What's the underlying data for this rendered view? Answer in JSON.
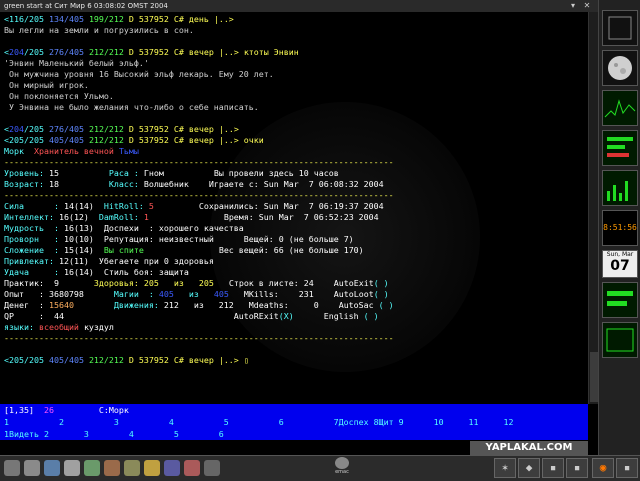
{
  "window": {
    "title": "green start at Сит Мир  6 03:08:02 OMST 2004"
  },
  "terminal": {
    "lines": [
      {
        "segs": [
          {
            "t": "<116/205 ",
            "c": "cyan"
          },
          {
            "t": "134/405 ",
            "c": "blue"
          },
          {
            "t": "199/212 ",
            "c": "green"
          },
          {
            "t": "D 537952 C# день |..> ",
            "c": "yellow"
          }
        ]
      },
      {
        "segs": [
          {
            "t": "Вы легли на земли и погрузились в сон.",
            "c": "grey"
          }
        ]
      },
      {
        "segs": [
          {
            "t": "",
            "c": "grey"
          }
        ]
      },
      {
        "segs": [
          {
            "t": "<",
            "c": "cyan"
          },
          {
            "t": "204",
            "c": "dblue"
          },
          {
            "t": "/205 ",
            "c": "cyan"
          },
          {
            "t": "276/405 ",
            "c": "blue"
          },
          {
            "t": "212/212 ",
            "c": "green"
          },
          {
            "t": "D 537952 C# вечер |..> ",
            "c": "yellow"
          },
          {
            "t": "ктоты Энвин",
            "c": "yellow"
          }
        ]
      },
      {
        "segs": [
          {
            "t": "'Энвин Маленький белый эльф.'",
            "c": "grey"
          }
        ]
      },
      {
        "segs": [
          {
            "t": " Он мужчина уровня 16 Высокий эльф лекарь. Ему 20 лет.",
            "c": "grey"
          }
        ]
      },
      {
        "segs": [
          {
            "t": " Он мирный игрок.",
            "c": "grey"
          }
        ]
      },
      {
        "segs": [
          {
            "t": " Он поклоняется Ульмо.",
            "c": "grey"
          }
        ]
      },
      {
        "segs": [
          {
            "t": " У Энвина не было желания что-либо о себе написать.",
            "c": "grey"
          }
        ]
      },
      {
        "segs": [
          {
            "t": "",
            "c": "grey"
          }
        ]
      },
      {
        "segs": [
          {
            "t": "<",
            "c": "cyan"
          },
          {
            "t": "204",
            "c": "dblue"
          },
          {
            "t": "/205 ",
            "c": "cyan"
          },
          {
            "t": "276/405 ",
            "c": "blue"
          },
          {
            "t": "212/212 ",
            "c": "green"
          },
          {
            "t": "D 537952 C# вечер |..>",
            "c": "yellow"
          }
        ]
      },
      {
        "segs": [
          {
            "t": "<205/205 ",
            "c": "cyan"
          },
          {
            "t": "405/405 ",
            "c": "blue"
          },
          {
            "t": "212/212 ",
            "c": "green"
          },
          {
            "t": "D 537952 C# вечер |..> ",
            "c": "yellow"
          },
          {
            "t": "очки",
            "c": "yellow"
          }
        ]
      },
      {
        "segs": [
          {
            "t": "Морк  ",
            "c": "cyan"
          },
          {
            "t": "Хранитель вечной ",
            "c": "red"
          },
          {
            "t": "Тьмы",
            "c": "dblue"
          }
        ]
      },
      {
        "segs": [
          {
            "t": "------------------------------------------------------------------------------",
            "c": "yellow"
          }
        ]
      },
      {
        "segs": [
          {
            "t": "Уровень: ",
            "c": "cyan"
          },
          {
            "t": "15          ",
            "c": "white"
          },
          {
            "t": "Раса : ",
            "c": "cyan"
          },
          {
            "t": "Гном          Вы провели здесь 10 часов",
            "c": "white"
          }
        ]
      },
      {
        "segs": [
          {
            "t": "Возраст: ",
            "c": "cyan"
          },
          {
            "t": "18          ",
            "c": "white"
          },
          {
            "t": "Класс: ",
            "c": "cyan"
          },
          {
            "t": "Волшебник    Играете с: Sun Mar  7 06:08:32 2004",
            "c": "white"
          }
        ]
      },
      {
        "segs": [
          {
            "t": "------------------------------------------------------------------------------",
            "c": "yellow"
          }
        ]
      },
      {
        "segs": [
          {
            "t": "Сила      : ",
            "c": "cyan"
          },
          {
            "t": "14(14)  ",
            "c": "white"
          },
          {
            "t": "HitRoll: ",
            "c": "cyan"
          },
          {
            "t": "5",
            "c": "red"
          },
          {
            "t": "         Сохранились: Sun Mar  7 06:19:37 2004",
            "c": "white"
          }
        ]
      },
      {
        "segs": [
          {
            "t": "Интеллект: ",
            "c": "cyan"
          },
          {
            "t": "16(12)  ",
            "c": "white"
          },
          {
            "t": "DamRoll: ",
            "c": "cyan"
          },
          {
            "t": "1",
            "c": "red"
          },
          {
            "t": "               Время: Sun Mar  7 06:52:23 2004",
            "c": "white"
          }
        ]
      },
      {
        "segs": [
          {
            "t": "Мудрость  : ",
            "c": "cyan"
          },
          {
            "t": "16(13)  ",
            "c": "white"
          },
          {
            "t": "Доспехи  : хорошего качества",
            "c": "white"
          }
        ]
      },
      {
        "segs": [
          {
            "t": "Проворн   : ",
            "c": "cyan"
          },
          {
            "t": "10(10)  ",
            "c": "white"
          },
          {
            "t": "Репутация: неизвестный      Вещей: 0 (не больше 7)",
            "c": "white"
          }
        ]
      },
      {
        "segs": [
          {
            "t": "Сложение  : ",
            "c": "cyan"
          },
          {
            "t": "15(14)  ",
            "c": "white"
          },
          {
            "t": "Вы спите",
            "c": "green"
          },
          {
            "t": "               Вес вещей: 66 (не больше 170)",
            "c": "white"
          }
        ]
      },
      {
        "segs": [
          {
            "t": "Привлекат: ",
            "c": "cyan"
          },
          {
            "t": "12(11)  ",
            "c": "white"
          },
          {
            "t": "Убегаете при 0 здоровья",
            "c": "white"
          }
        ]
      },
      {
        "segs": [
          {
            "t": "Удача     : ",
            "c": "cyan"
          },
          {
            "t": "16(14)  ",
            "c": "white"
          },
          {
            "t": "Стиль боя: защита",
            "c": "white"
          }
        ]
      },
      {
        "segs": [
          {
            "t": "Практик:  ",
            "c": "white"
          },
          {
            "t": "9       ",
            "c": "white"
          },
          {
            "t": "Здоровья: ",
            "c": "yellow"
          },
          {
            "t": "205   ",
            "c": "yellow"
          },
          {
            "t": "из   ",
            "c": "yellow"
          },
          {
            "t": "205   ",
            "c": "yellow"
          },
          {
            "t": "Строк в листе: 24    AutoExit",
            "c": "white"
          },
          {
            "t": "( )",
            "c": "cyan"
          }
        ]
      },
      {
        "segs": [
          {
            "t": "Опыт   : 3680798      ",
            "c": "white"
          },
          {
            "t": "Магии  : ",
            "c": "cyan"
          },
          {
            "t": "405   ",
            "c": "dblue"
          },
          {
            "t": "из   ",
            "c": "cyan"
          },
          {
            "t": "405   ",
            "c": "dblue"
          },
          {
            "t": "MKills:    231    AutoLoot",
            "c": "white"
          },
          {
            "t": "( )",
            "c": "cyan"
          }
        ]
      },
      {
        "segs": [
          {
            "t": "Денег  : ",
            "c": "white"
          },
          {
            "t": "15640        ",
            "c": "orange"
          },
          {
            "t": "Движения: ",
            "c": "cyan"
          },
          {
            "t": "212   из   212   ",
            "c": "white"
          },
          {
            "t": "Mdeaths:     0    AutoSac ",
            "c": "white"
          },
          {
            "t": "( )",
            "c": "cyan"
          }
        ]
      },
      {
        "segs": [
          {
            "t": "QP     :  44                                  AutoRExit",
            "c": "white"
          },
          {
            "t": "(X)",
            "c": "cyan"
          },
          {
            "t": "      English ",
            "c": "white"
          },
          {
            "t": "( )",
            "c": "cyan"
          }
        ]
      },
      {
        "segs": [
          {
            "t": "языки: ",
            "c": "cyan"
          },
          {
            "t": "всеобщий ",
            "c": "red"
          },
          {
            "t": "куздул",
            "c": "white"
          }
        ]
      },
      {
        "segs": [
          {
            "t": "------------------------------------------------------------------------------",
            "c": "yellow"
          }
        ]
      },
      {
        "segs": [
          {
            "t": "",
            "c": "grey"
          }
        ]
      },
      {
        "segs": [
          {
            "t": "<205/205 ",
            "c": "cyan"
          },
          {
            "t": "405/405 ",
            "c": "blue"
          },
          {
            "t": "212/212 ",
            "c": "green"
          },
          {
            "t": "D 537952 C# вечер |..> ",
            "c": "yellow"
          },
          {
            "t": "▯",
            "c": "yellow"
          }
        ]
      }
    ]
  },
  "statusbar": {
    "lines": [
      {
        "segs": [
          {
            "t": "[1,35]  ",
            "c": "white"
          },
          {
            "t": "26",
            "c": "mag"
          },
          {
            "t": "         C:Морк",
            "c": "white"
          }
        ]
      },
      {
        "segs": [
          {
            "t": "1          2          3          4          5          6          7Доспех 8Щит 9      10     11     12",
            "c": "cyan"
          }
        ]
      },
      {
        "segs": [
          {
            "t": "1Видеть 2       3        4        5        6",
            "c": "cyan"
          }
        ]
      }
    ]
  },
  "dock": {
    "clock_time": "8:51:56",
    "calendar_day": "Sun, Mar",
    "calendar_date": "07"
  },
  "taskbar": {
    "logo": "YAPLAKAL.COM",
    "emacs_label": "emac"
  }
}
